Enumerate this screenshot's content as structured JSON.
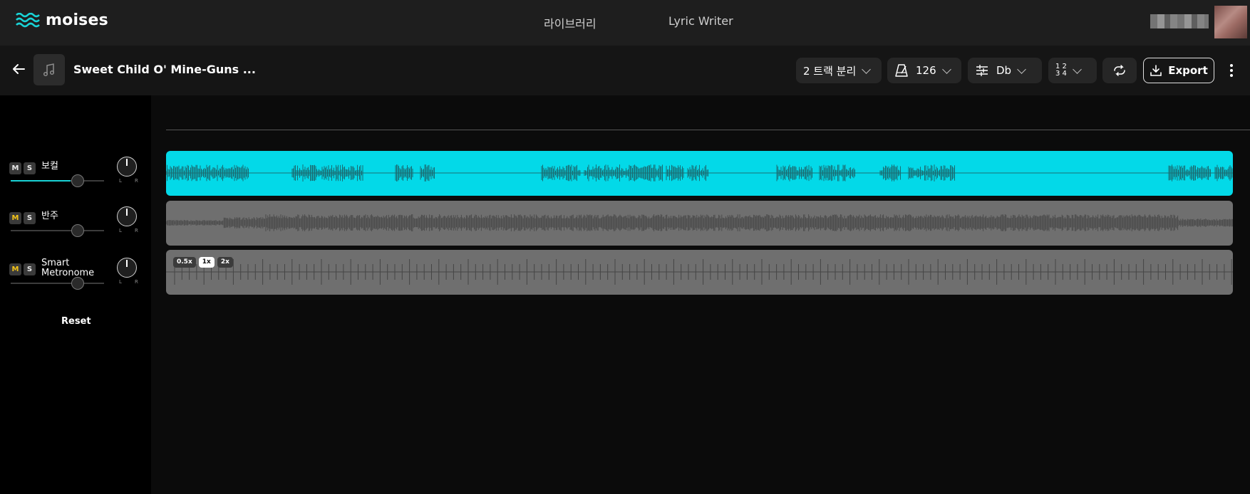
{
  "app": {
    "brand": "moises",
    "nav": {
      "library": "라이브러리",
      "lyric_writer": "Lyric Writer"
    }
  },
  "song": {
    "title": "Sweet Child O' Mine-Guns ...",
    "separation": "2 트랙 분리",
    "tempo": "126",
    "key": "Db",
    "meter_top": "1 2",
    "meter_bottom": "3 4",
    "export_label": "Export"
  },
  "mixer": {
    "mute_label": "M",
    "solo_label": "S",
    "pan_left": "L",
    "pan_right": "R",
    "tracks": [
      {
        "name": "보컬",
        "volume": 0.64,
        "mute_active": false,
        "accent": "#19d3d6"
      },
      {
        "name": "반주",
        "volume": 0.64,
        "mute_active": true
      },
      {
        "name": "Smart\nMetronome",
        "volume": 0.64,
        "mute_active": true
      }
    ],
    "reset_label": "Reset"
  },
  "metronome": {
    "speeds": [
      "0.5x",
      "1x",
      "2x"
    ],
    "selected_speed": "1x"
  },
  "colors": {
    "vocal_lane": "#03d9e8",
    "muted_lane": "#6f6f6f",
    "mute_active": "#f5c518"
  }
}
